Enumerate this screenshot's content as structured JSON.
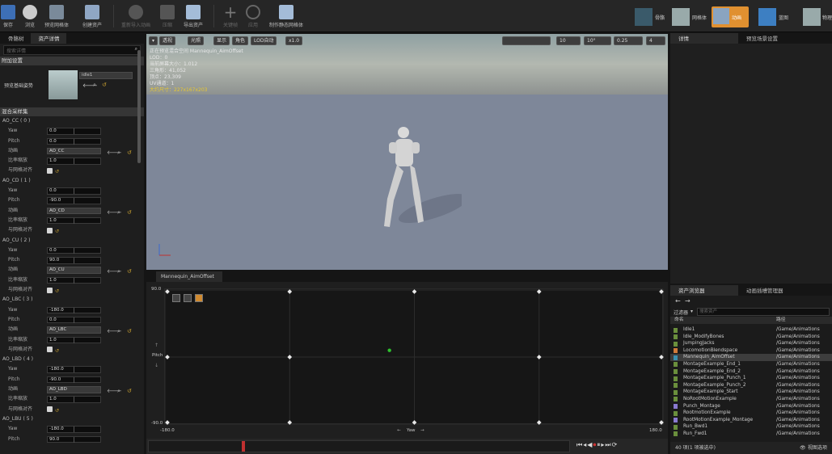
{
  "toolbar": {
    "buttons": [
      {
        "label": "保存",
        "icon": "save-icon",
        "dim": false
      },
      {
        "label": "浏览",
        "icon": "browse-icon",
        "dim": false
      },
      {
        "label": "预览网格体",
        "icon": "preview-mesh-icon",
        "dim": false
      },
      {
        "label": "创建资产",
        "icon": "create-asset-icon",
        "dim": false
      },
      {
        "label": "重新导入动画",
        "icon": "reimport-icon",
        "dim": true
      },
      {
        "label": "压缩",
        "icon": "compress-icon",
        "dim": true
      },
      {
        "label": "导出资产",
        "icon": "export-icon",
        "dim": false
      },
      {
        "label": "关键帧",
        "icon": "key-icon",
        "dim": true
      },
      {
        "label": "应用",
        "icon": "apply-icon",
        "dim": true
      },
      {
        "label": "制作静态网格体",
        "icon": "static-mesh-icon",
        "dim": false
      }
    ],
    "modes": [
      "骨骼",
      "网格体",
      "动画",
      "蓝图",
      "物理"
    ]
  },
  "left": {
    "tabs": [
      "骨骼树",
      "资产详情"
    ],
    "search_placeholder": "搜索详情",
    "section_additional": "附加设置",
    "preview_pose_label": "预览基础姿势",
    "preview_pose_value": "idle1",
    "section_samples": "混合采样集",
    "samples": [
      {
        "name": "AO_CC ( 0 )",
        "yaw": "0.0",
        "pitch": "0.0",
        "anim": "AO_CC",
        "rate": "1.0"
      },
      {
        "name": "AO_CD ( 1 )",
        "yaw": "0.0",
        "pitch": "-90.0",
        "anim": "AO_CD",
        "rate": "1.0"
      },
      {
        "name": "AO_CU ( 2 )",
        "yaw": "0.0",
        "pitch": "90.0",
        "anim": "AO_CU",
        "rate": "1.0"
      },
      {
        "name": "AO_LBC ( 3 )",
        "yaw": "-180.0",
        "pitch": "0.0",
        "anim": "AO_LBC",
        "rate": "1.0"
      },
      {
        "name": "AO_LBD ( 4 )",
        "yaw": "-180.0",
        "pitch": "-90.0",
        "anim": "AO_LBD",
        "rate": "1.0"
      },
      {
        "name": "AO_LBU ( 5 )",
        "yaw": "-180.0",
        "pitch": "90.0",
        "anim": "",
        "rate": ""
      }
    ],
    "labels": {
      "yaw": "Yaw",
      "pitch": "Pitch",
      "anim": "动画",
      "rate": "比率缩放",
      "snap": "与网格对齐"
    }
  },
  "viewport": {
    "buttons": [
      "透视",
      "光照",
      "显示",
      "角色",
      "LOD自动",
      "x1.0"
    ],
    "right_values": [
      "10",
      "10°",
      "0.25",
      "4"
    ],
    "overlay": [
      "正在预览混合空间 Mannequin_AimOffset",
      "LOD：0",
      "当前屏幕大小：1.012",
      "三角形：41,052",
      "顶点：23,309",
      "UV通道：1",
      "大约尺寸：227x167x203"
    ]
  },
  "blendspace": {
    "tab": "Mannequin_AimOffset",
    "y_max": "90.0",
    "y_min": "-90.0",
    "y_label": "Pitch",
    "x_min": "-180.0",
    "x_max": "180.0",
    "x_label": "Yaw"
  },
  "chart_data": {
    "type": "scatter",
    "xlabel": "Yaw",
    "ylabel": "Pitch",
    "xlim": [
      -180,
      180
    ],
    "ylim": [
      -90,
      90
    ],
    "samples": [
      {
        "x": -180,
        "y": 90
      },
      {
        "x": -90,
        "y": 90
      },
      {
        "x": 0,
        "y": 90
      },
      {
        "x": 90,
        "y": 90
      },
      {
        "x": 180,
        "y": 90
      },
      {
        "x": -180,
        "y": 0
      },
      {
        "x": -90,
        "y": 0
      },
      {
        "x": 90,
        "y": 0
      },
      {
        "x": 180,
        "y": 0
      },
      {
        "x": -180,
        "y": -90
      },
      {
        "x": -90,
        "y": -90
      },
      {
        "x": 0,
        "y": -90
      },
      {
        "x": 90,
        "y": -90
      },
      {
        "x": 180,
        "y": -90
      }
    ],
    "preview_point": {
      "x": -18,
      "y": 9
    }
  },
  "right": {
    "tabs": [
      "详情",
      "预览场景设置"
    ],
    "asset_tabs": [
      "资产浏览器",
      "动画插槽管理器"
    ],
    "filter_label": "过滤器",
    "search_placeholder": "搜索资产",
    "columns": [
      "命名",
      "路径"
    ],
    "assets": [
      {
        "name": "Idle1",
        "path": "/Game/Animations",
        "color": "#6a8f3c"
      },
      {
        "name": "Idle_ModifyBones",
        "path": "/Game/Animations",
        "color": "#6a8f3c"
      },
      {
        "name": "JumpingJacks",
        "path": "/Game/Animations",
        "color": "#6a8f3c"
      },
      {
        "name": "LocomotionBlendspace",
        "path": "/Game/Animations",
        "color": "#d07a3a"
      },
      {
        "name": "Mannequin_AimOffset",
        "path": "/Game/Animations",
        "color": "#3a8fb0",
        "selected": true
      },
      {
        "name": "MontageExample_End_1",
        "path": "/Game/Animations",
        "color": "#6a8f3c"
      },
      {
        "name": "MontageExample_End_2",
        "path": "/Game/Animations",
        "color": "#6a8f3c"
      },
      {
        "name": "MontageExample_Punch_1",
        "path": "/Game/Animations",
        "color": "#6a8f3c"
      },
      {
        "name": "MontageExample_Punch_2",
        "path": "/Game/Animations",
        "color": "#6a8f3c"
      },
      {
        "name": "MontageExample_Start",
        "path": "/Game/Animations",
        "color": "#6a8f3c"
      },
      {
        "name": "NoRootMotionExample",
        "path": "/Game/Animations",
        "color": "#6a8f3c"
      },
      {
        "name": "Punch_Montage",
        "path": "/Game/Animations",
        "color": "#8a7ad0"
      },
      {
        "name": "RootmotionExample",
        "path": "/Game/Animations",
        "color": "#6a8f3c"
      },
      {
        "name": "RootMotionExample_Montage",
        "path": "/Game/Animations",
        "color": "#8a7ad0"
      },
      {
        "name": "Run_Bwd1",
        "path": "/Game/Animations",
        "color": "#6a8f3c"
      },
      {
        "name": "Run_Fwd1",
        "path": "/Game/Animations",
        "color": "#6a8f3c"
      }
    ],
    "status": "40 项(1 项被选中)",
    "view_options": "视图选项"
  }
}
